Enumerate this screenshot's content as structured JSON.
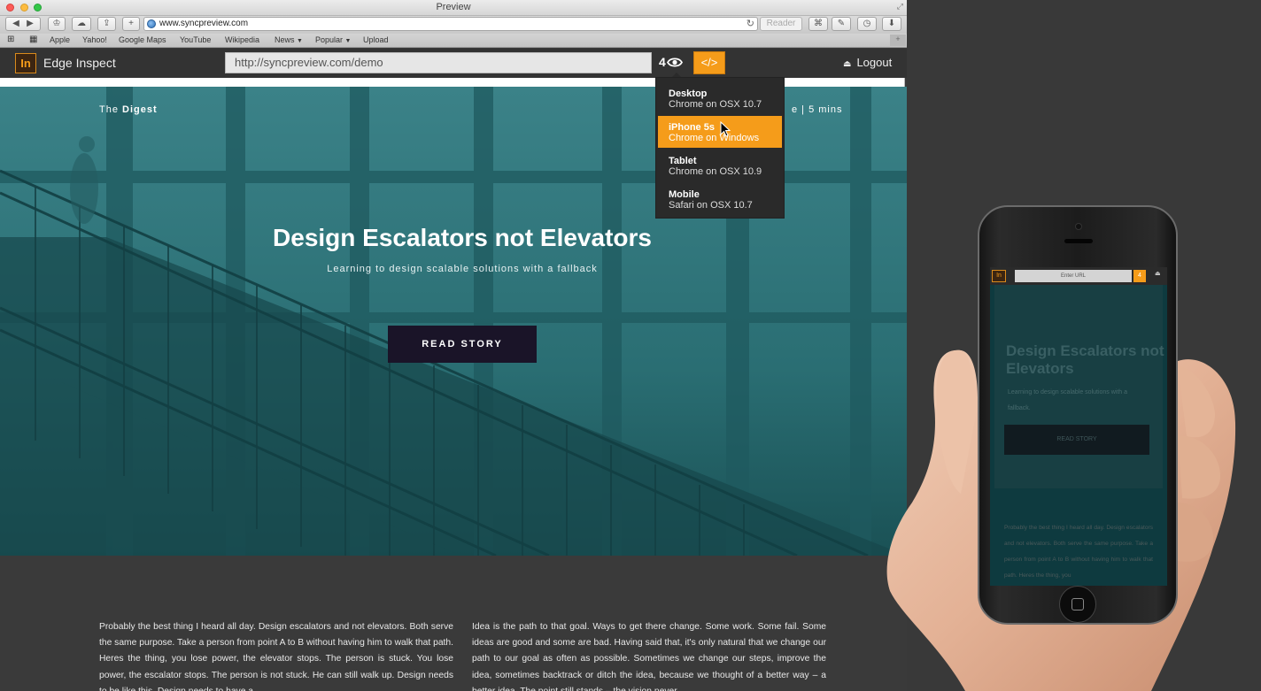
{
  "window": {
    "title": "Preview"
  },
  "browser": {
    "url": "www.syncpreview.com",
    "reader_label": "Reader"
  },
  "bookmarks": [
    {
      "label": "Apple",
      "caret": ""
    },
    {
      "label": "Yahoo!",
      "caret": ""
    },
    {
      "label": "Google Maps",
      "caret": ""
    },
    {
      "label": "YouTube",
      "caret": ""
    },
    {
      "label": "Wikipedia",
      "caret": ""
    },
    {
      "label": "News",
      "caret": "▼"
    },
    {
      "label": "Popular",
      "caret": "▼"
    },
    {
      "label": "Upload",
      "caret": ""
    }
  ],
  "edge": {
    "logo": "In",
    "app_name": "Edge Inspect",
    "url": "http://syncpreview.com/demo",
    "device_count": "4",
    "code_label": "</>",
    "logout_label": "Logout"
  },
  "devices": [
    {
      "name": "Desktop",
      "sub": "Chrome on OSX 10.7",
      "selected": false
    },
    {
      "name": "iPhone 5s",
      "sub": "Chrome on Windows",
      "selected": true
    },
    {
      "name": "Tablet",
      "sub": "Chrome on OSX 10.9",
      "selected": false
    },
    {
      "name": "Mobile",
      "sub": "Safari on OSX 10.7",
      "selected": false
    }
  ],
  "page": {
    "brand_prefix": "The",
    "brand_name": "Digest",
    "read_time": "e | 5 mins",
    "headline": "Design Escalators not Elevators",
    "subline": "Learning to design scalable solutions with a fallback",
    "button": "READ STORY",
    "col1": "Probably the best thing I heard all day. Design escalators and not elevators. Both serve the same purpose. Take a person from point A to B without having him to walk that path. Heres the thing, you lose power, the elevator stops. The person is stuck. You lose power, the escalator stops. The person is not stuck. He can still walk up. Design needs to be like this. Design needs to have a",
    "col2": "Idea is the path to that goal. Ways to get there change. Some work. Some fail. Some ideas are good and some are bad. Having said that, it's only natural that we change our path to our goal as often as possible. Sometimes we change our steps, improve the idea, sometimes backtrack or ditch the idea, because we thought of a better way – a better idea. The point still stands – the vision never"
  },
  "mobile": {
    "logo": "In",
    "url_placeholder": "Enter URL",
    "count": "4",
    "headline": "Design Escalators not Elevators",
    "subline": "Learning to design scalable solutions with a fallback.",
    "button": "READ STORY",
    "text": "Probably the best thing I heard all day. Design escalators and not elevators. Both serve the same purpose. Take a person from point A to B without having him to walk that path. Heres the thing, you"
  },
  "colors": {
    "accent": "#f59c1a",
    "hero": "#2c6f74",
    "dark": "#333333"
  }
}
